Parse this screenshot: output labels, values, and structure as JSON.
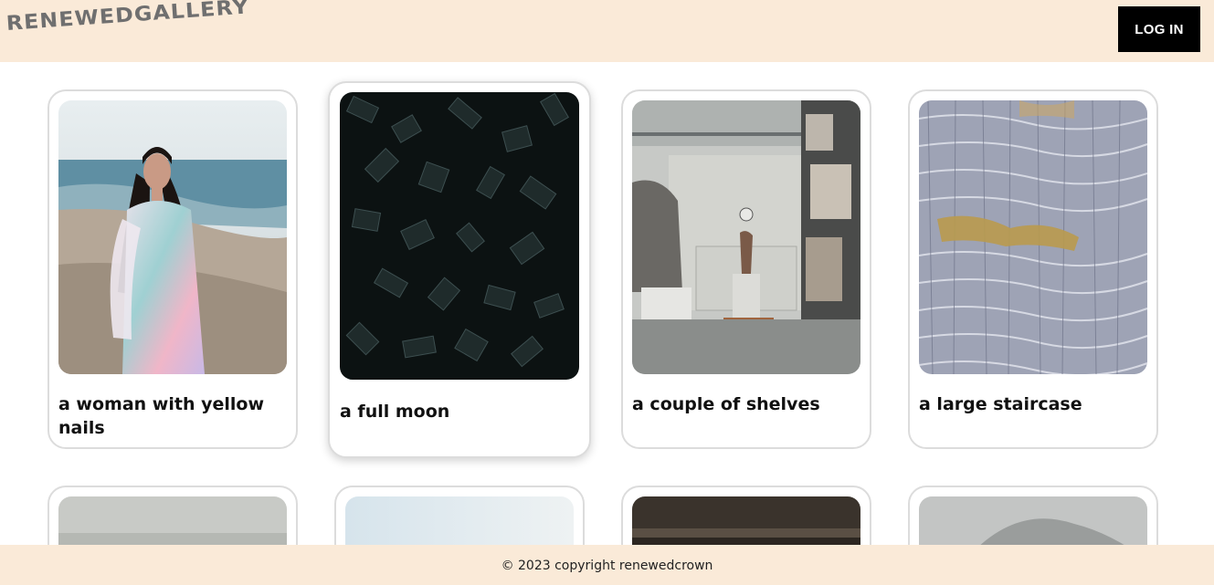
{
  "header": {
    "logo": "RENEWEDGALLERY",
    "login_label": "LOG IN"
  },
  "gallery": {
    "items": [
      {
        "caption": "a woman with yellow nails"
      },
      {
        "caption": "a full moon"
      },
      {
        "caption": "a couple of shelves"
      },
      {
        "caption": "a large staircase"
      },
      {
        "caption": ""
      },
      {
        "caption": ""
      },
      {
        "caption": ""
      },
      {
        "caption": ""
      }
    ]
  },
  "footer": {
    "copyright": "© 2023 copyright renewedcrown"
  },
  "colors": {
    "header_bg": "#faead8",
    "button_bg": "#000000",
    "card_border": "#dcdcdc"
  }
}
